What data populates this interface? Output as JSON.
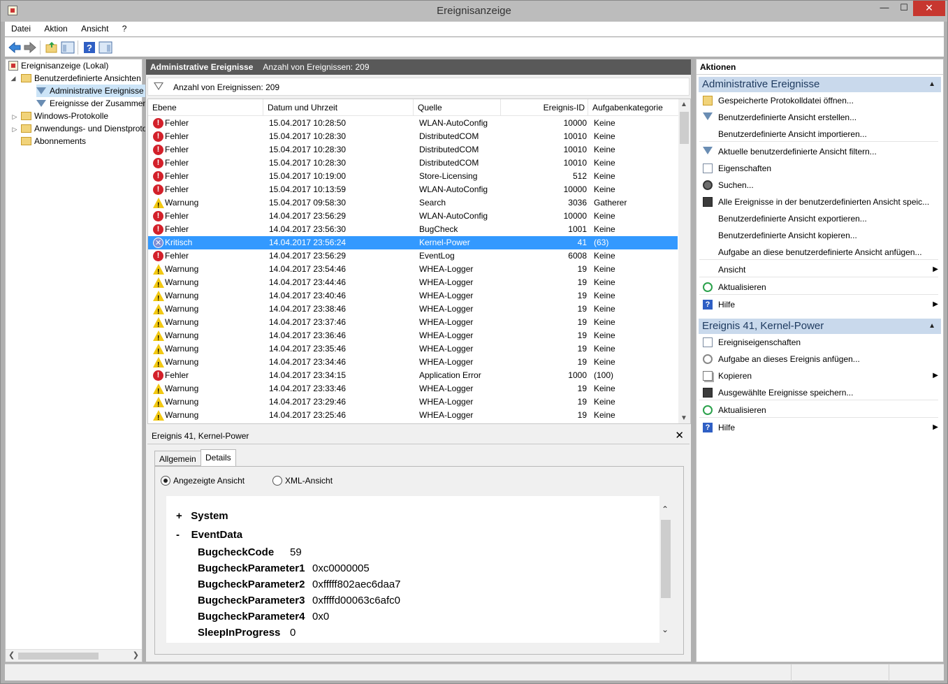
{
  "window": {
    "title": "Ereignisanzeige",
    "min": "—",
    "max": "☐",
    "close": "✕"
  },
  "menu": [
    "Datei",
    "Aktion",
    "Ansicht",
    "?"
  ],
  "tree": {
    "root": "Ereignisanzeige (Lokal)",
    "custom_views": "Benutzerdefinierte Ansichten",
    "admin_events": "Administrative Ereignisse",
    "summary_events": "Ereignisse der Zusammenfassung",
    "windows_logs": "Windows-Protokolle",
    "app_logs": "Anwendungs- und Dienstprotokolle",
    "subscriptions": "Abonnements"
  },
  "center": {
    "header_title": "Administrative Ereignisse",
    "header_count": "Anzahl von Ereignissen: 209",
    "filter_text": "Anzahl von Ereignissen: 209",
    "columns": [
      "Ebene",
      "Datum und Uhrzeit",
      "Quelle",
      "Ereignis-ID",
      "Aufgabenkategorie"
    ],
    "rows": [
      {
        "level": "Fehler",
        "icon": "error",
        "date": "15.04.2017 10:28:50",
        "source": "WLAN-AutoConfig",
        "id": "10000",
        "cat": "Keine"
      },
      {
        "level": "Fehler",
        "icon": "error",
        "date": "15.04.2017 10:28:30",
        "source": "DistributedCOM",
        "id": "10010",
        "cat": "Keine"
      },
      {
        "level": "Fehler",
        "icon": "error",
        "date": "15.04.2017 10:28:30",
        "source": "DistributedCOM",
        "id": "10010",
        "cat": "Keine"
      },
      {
        "level": "Fehler",
        "icon": "error",
        "date": "15.04.2017 10:28:30",
        "source": "DistributedCOM",
        "id": "10010",
        "cat": "Keine"
      },
      {
        "level": "Fehler",
        "icon": "error",
        "date": "15.04.2017 10:19:00",
        "source": "Store-Licensing",
        "id": "512",
        "cat": "Keine"
      },
      {
        "level": "Fehler",
        "icon": "error",
        "date": "15.04.2017 10:13:59",
        "source": "WLAN-AutoConfig",
        "id": "10000",
        "cat": "Keine"
      },
      {
        "level": "Warnung",
        "icon": "warning",
        "date": "15.04.2017 09:58:30",
        "source": "Search",
        "id": "3036",
        "cat": "Gatherer"
      },
      {
        "level": "Fehler",
        "icon": "error",
        "date": "14.04.2017 23:56:29",
        "source": "WLAN-AutoConfig",
        "id": "10000",
        "cat": "Keine"
      },
      {
        "level": "Fehler",
        "icon": "error",
        "date": "14.04.2017 23:56:30",
        "source": "BugCheck",
        "id": "1001",
        "cat": "Keine"
      },
      {
        "level": "Kritisch",
        "icon": "critical",
        "date": "14.04.2017 23:56:24",
        "source": "Kernel-Power",
        "id": "41",
        "cat": "(63)",
        "selected": true
      },
      {
        "level": "Fehler",
        "icon": "error",
        "date": "14.04.2017 23:56:29",
        "source": "EventLog",
        "id": "6008",
        "cat": "Keine"
      },
      {
        "level": "Warnung",
        "icon": "warning",
        "date": "14.04.2017 23:54:46",
        "source": "WHEA-Logger",
        "id": "19",
        "cat": "Keine"
      },
      {
        "level": "Warnung",
        "icon": "warning",
        "date": "14.04.2017 23:44:46",
        "source": "WHEA-Logger",
        "id": "19",
        "cat": "Keine"
      },
      {
        "level": "Warnung",
        "icon": "warning",
        "date": "14.04.2017 23:40:46",
        "source": "WHEA-Logger",
        "id": "19",
        "cat": "Keine"
      },
      {
        "level": "Warnung",
        "icon": "warning",
        "date": "14.04.2017 23:38:46",
        "source": "WHEA-Logger",
        "id": "19",
        "cat": "Keine"
      },
      {
        "level": "Warnung",
        "icon": "warning",
        "date": "14.04.2017 23:37:46",
        "source": "WHEA-Logger",
        "id": "19",
        "cat": "Keine"
      },
      {
        "level": "Warnung",
        "icon": "warning",
        "date": "14.04.2017 23:36:46",
        "source": "WHEA-Logger",
        "id": "19",
        "cat": "Keine"
      },
      {
        "level": "Warnung",
        "icon": "warning",
        "date": "14.04.2017 23:35:46",
        "source": "WHEA-Logger",
        "id": "19",
        "cat": "Keine"
      },
      {
        "level": "Warnung",
        "icon": "warning",
        "date": "14.04.2017 23:34:46",
        "source": "WHEA-Logger",
        "id": "19",
        "cat": "Keine"
      },
      {
        "level": "Fehler",
        "icon": "error",
        "date": "14.04.2017 23:34:15",
        "source": "Application Error",
        "id": "1000",
        "cat": "(100)"
      },
      {
        "level": "Warnung",
        "icon": "warning",
        "date": "14.04.2017 23:33:46",
        "source": "WHEA-Logger",
        "id": "19",
        "cat": "Keine"
      },
      {
        "level": "Warnung",
        "icon": "warning",
        "date": "14.04.2017 23:29:46",
        "source": "WHEA-Logger",
        "id": "19",
        "cat": "Keine"
      },
      {
        "level": "Warnung",
        "icon": "warning",
        "date": "14.04.2017 23:25:46",
        "source": "WHEA-Logger",
        "id": "19",
        "cat": "Keine"
      }
    ]
  },
  "detail": {
    "title": "Ereignis 41, Kernel-Power",
    "close": "✕",
    "tabs": [
      "Allgemein",
      "Details"
    ],
    "radio_friendly": "Angezeigte Ansicht",
    "radio_xml": "XML-Ansicht",
    "system_toggle": "+",
    "system_label": "System",
    "eventdata_toggle": "-",
    "eventdata_label": "EventData",
    "fields": [
      {
        "name": "BugcheckCode",
        "value": "59"
      },
      {
        "name": "BugcheckParameter1",
        "value": "0xc0000005"
      },
      {
        "name": "BugcheckParameter2",
        "value": "0xfffff802aec6daa7"
      },
      {
        "name": "BugcheckParameter3",
        "value": "0xffffd00063c6afc0"
      },
      {
        "name": "BugcheckParameter4",
        "value": "0x0"
      },
      {
        "name": "SleepInProgress",
        "value": "0"
      }
    ]
  },
  "actions": {
    "header": "Aktionen",
    "section1_title": "Administrative Ereignisse",
    "section1_items": [
      "Gespeicherte Protokolldatei öffnen...",
      "Benutzerdefinierte Ansicht erstellen...",
      "Benutzerdefinierte Ansicht importieren...",
      "Aktuelle benutzerdefinierte Ansicht filtern...",
      "Eigenschaften",
      "Suchen...",
      "Alle Ereignisse in der benutzerdefinierten Ansicht speic...",
      "Benutzerdefinierte Ansicht exportieren...",
      "Benutzerdefinierte Ansicht kopieren...",
      "Aufgabe an diese benutzerdefinierte Ansicht anfügen...",
      "Ansicht",
      "Aktualisieren",
      "Hilfe"
    ],
    "section2_title": "Ereignis 41, Kernel-Power",
    "section2_items": [
      "Ereigniseigenschaften",
      "Aufgabe an dieses Ereignis anfügen...",
      "Kopieren",
      "Ausgewählte Ereignisse speichern...",
      "Aktualisieren",
      "Hilfe"
    ]
  },
  "colors": {
    "selection": "#3399ff",
    "section_header": "#c9d9ec",
    "header_bar": "#595959",
    "error": "#d3202a",
    "warning": "#f2c811"
  }
}
